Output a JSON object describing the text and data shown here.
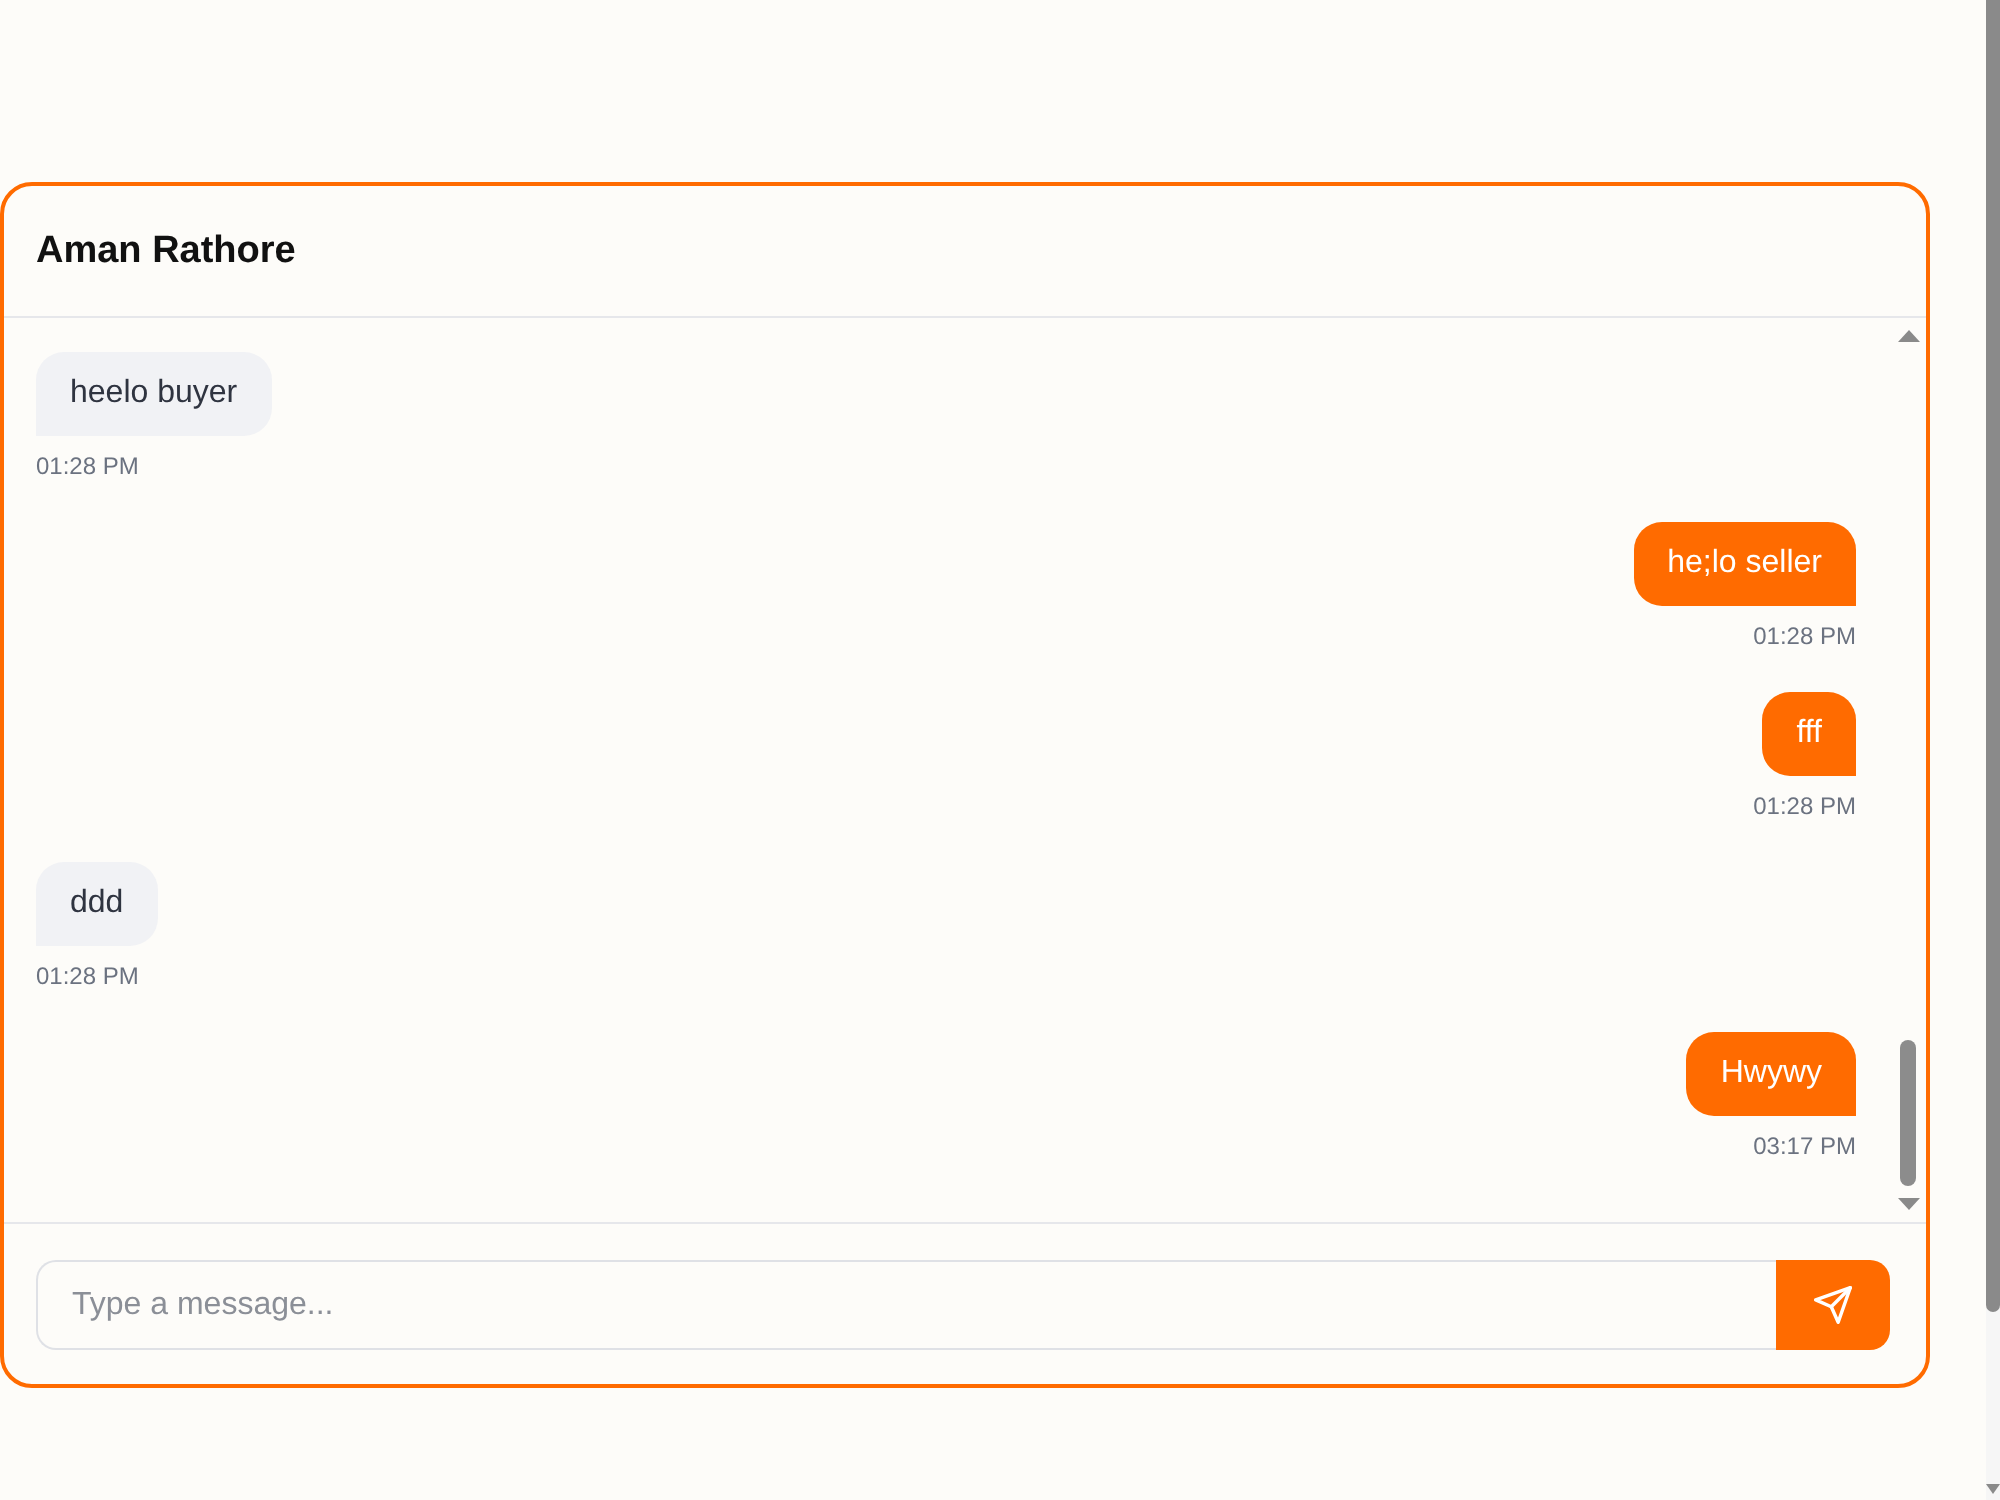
{
  "chat": {
    "contact_name": "Aman Rathore",
    "messages": [
      {
        "kind": "received",
        "text": "heelo buyer",
        "time": "01:28 PM"
      },
      {
        "kind": "sent",
        "text": "he;lo seller",
        "time": "01:28 PM"
      },
      {
        "kind": "sent",
        "text": "fff",
        "time": "01:28 PM"
      },
      {
        "kind": "received",
        "text": "ddd",
        "time": "01:28 PM"
      },
      {
        "kind": "sent",
        "text": "Hwywy",
        "time": "03:17 PM"
      }
    ],
    "composer": {
      "placeholder": "Type a message..."
    }
  }
}
